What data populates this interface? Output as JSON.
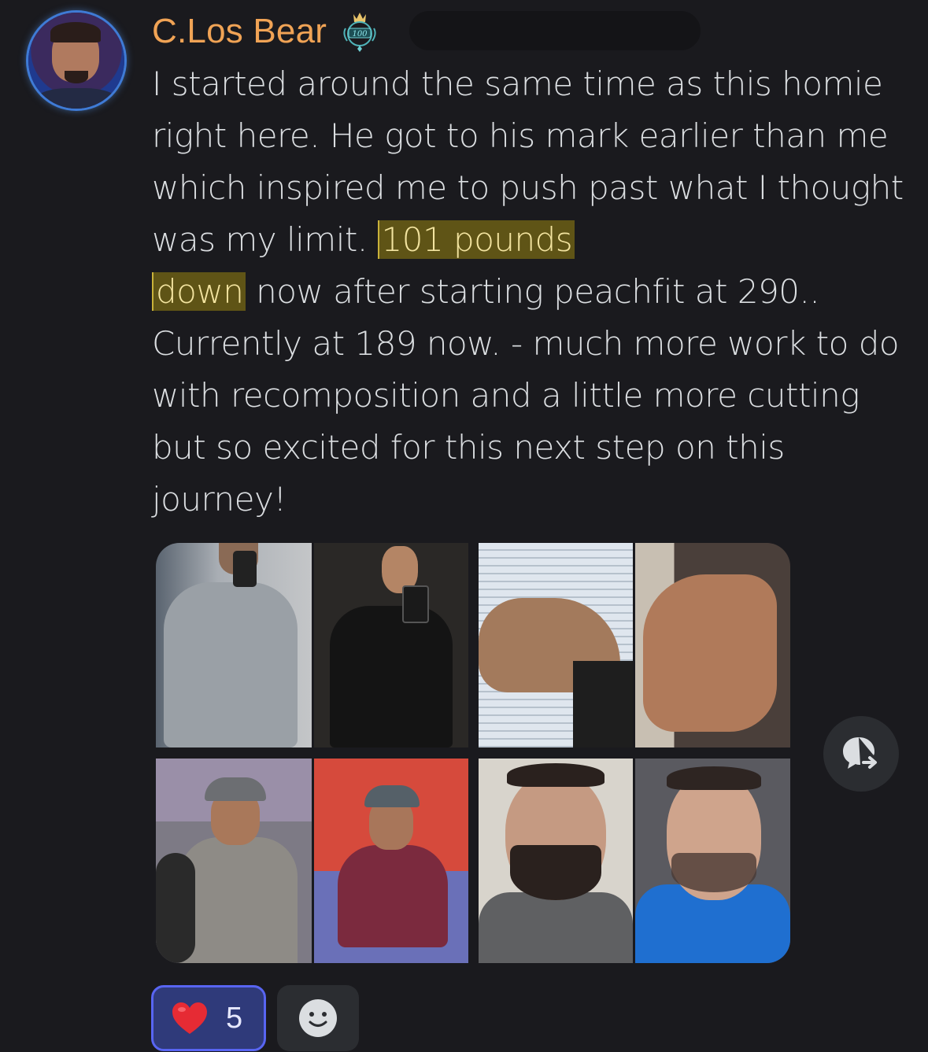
{
  "author": {
    "name": "C.Los Bear",
    "badge_icon": "crown-100-badge-icon",
    "badge_text": "100",
    "name_color": "#f0a355"
  },
  "message": {
    "text_before": "I started around the same time as this homie right here.  He got to his mark earlier than me which inspired me to push past what I thought was my limit. ",
    "highlight_1": "101 pounds",
    "highlight_2": "down",
    "text_after": " now after starting peachfit at 290.. Currently at 189 now. - much more work to do with recomposition and a little more cutting but so excited for this next step on this journey!",
    "highlight_color": "#5f5416"
  },
  "attachments": {
    "photos": [
      {
        "name": "before-front-mirror-photo"
      },
      {
        "name": "after-front-mirror-photo"
      },
      {
        "name": "before-arm-flex-photo"
      },
      {
        "name": "after-arm-flex-photo"
      },
      {
        "name": "before-gym-selfie-photo"
      },
      {
        "name": "after-gym-selfie-photo"
      },
      {
        "name": "before-face-photo"
      },
      {
        "name": "after-face-photo"
      }
    ]
  },
  "actions": {
    "forward_icon": "forward-message-icon"
  },
  "reactions": [
    {
      "emoji": "❤️",
      "icon": "heart-emoji-icon",
      "count": "5",
      "active": true
    },
    {
      "icon": "add-reaction-smiley-icon",
      "count": ""
    }
  ]
}
